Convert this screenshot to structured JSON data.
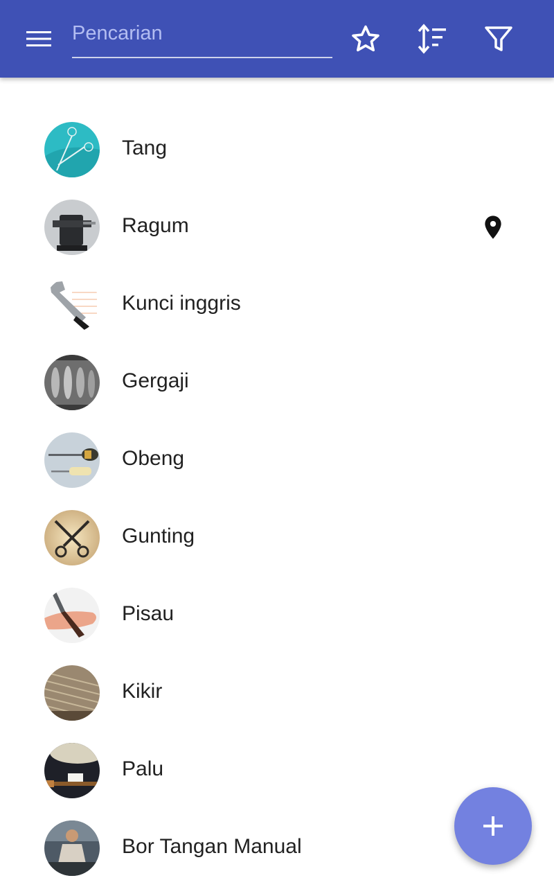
{
  "appbar": {
    "menu_icon": "hamburger-menu-icon",
    "search": {
      "placeholder": "Pencarian",
      "value": ""
    },
    "actions": [
      "star-icon",
      "sort-icon",
      "filter-icon"
    ],
    "color": "#3F51B5"
  },
  "items": [
    {
      "label": "Tang",
      "avatar_icon": "pliers-photo",
      "pinned": false
    },
    {
      "label": "Ragum",
      "avatar_icon": "vise-photo",
      "pinned": true
    },
    {
      "label": "Kunci inggris",
      "avatar_icon": "wrench-photo",
      "pinned": false
    },
    {
      "label": "Gergaji",
      "avatar_icon": "saw-photo",
      "pinned": false
    },
    {
      "label": "Obeng",
      "avatar_icon": "screwdriver-photo",
      "pinned": false
    },
    {
      "label": "Gunting",
      "avatar_icon": "scissors-photo",
      "pinned": false
    },
    {
      "label": "Pisau",
      "avatar_icon": "knife-photo",
      "pinned": false
    },
    {
      "label": "Kikir",
      "avatar_icon": "file-tool-photo",
      "pinned": false
    },
    {
      "label": "Palu",
      "avatar_icon": "hammer-photo",
      "pinned": false
    },
    {
      "label": "Bor Tangan Manual",
      "avatar_icon": "hand-drill-photo",
      "pinned": false
    }
  ],
  "fab": {
    "icon": "plus-icon",
    "color": "#7381E0"
  }
}
